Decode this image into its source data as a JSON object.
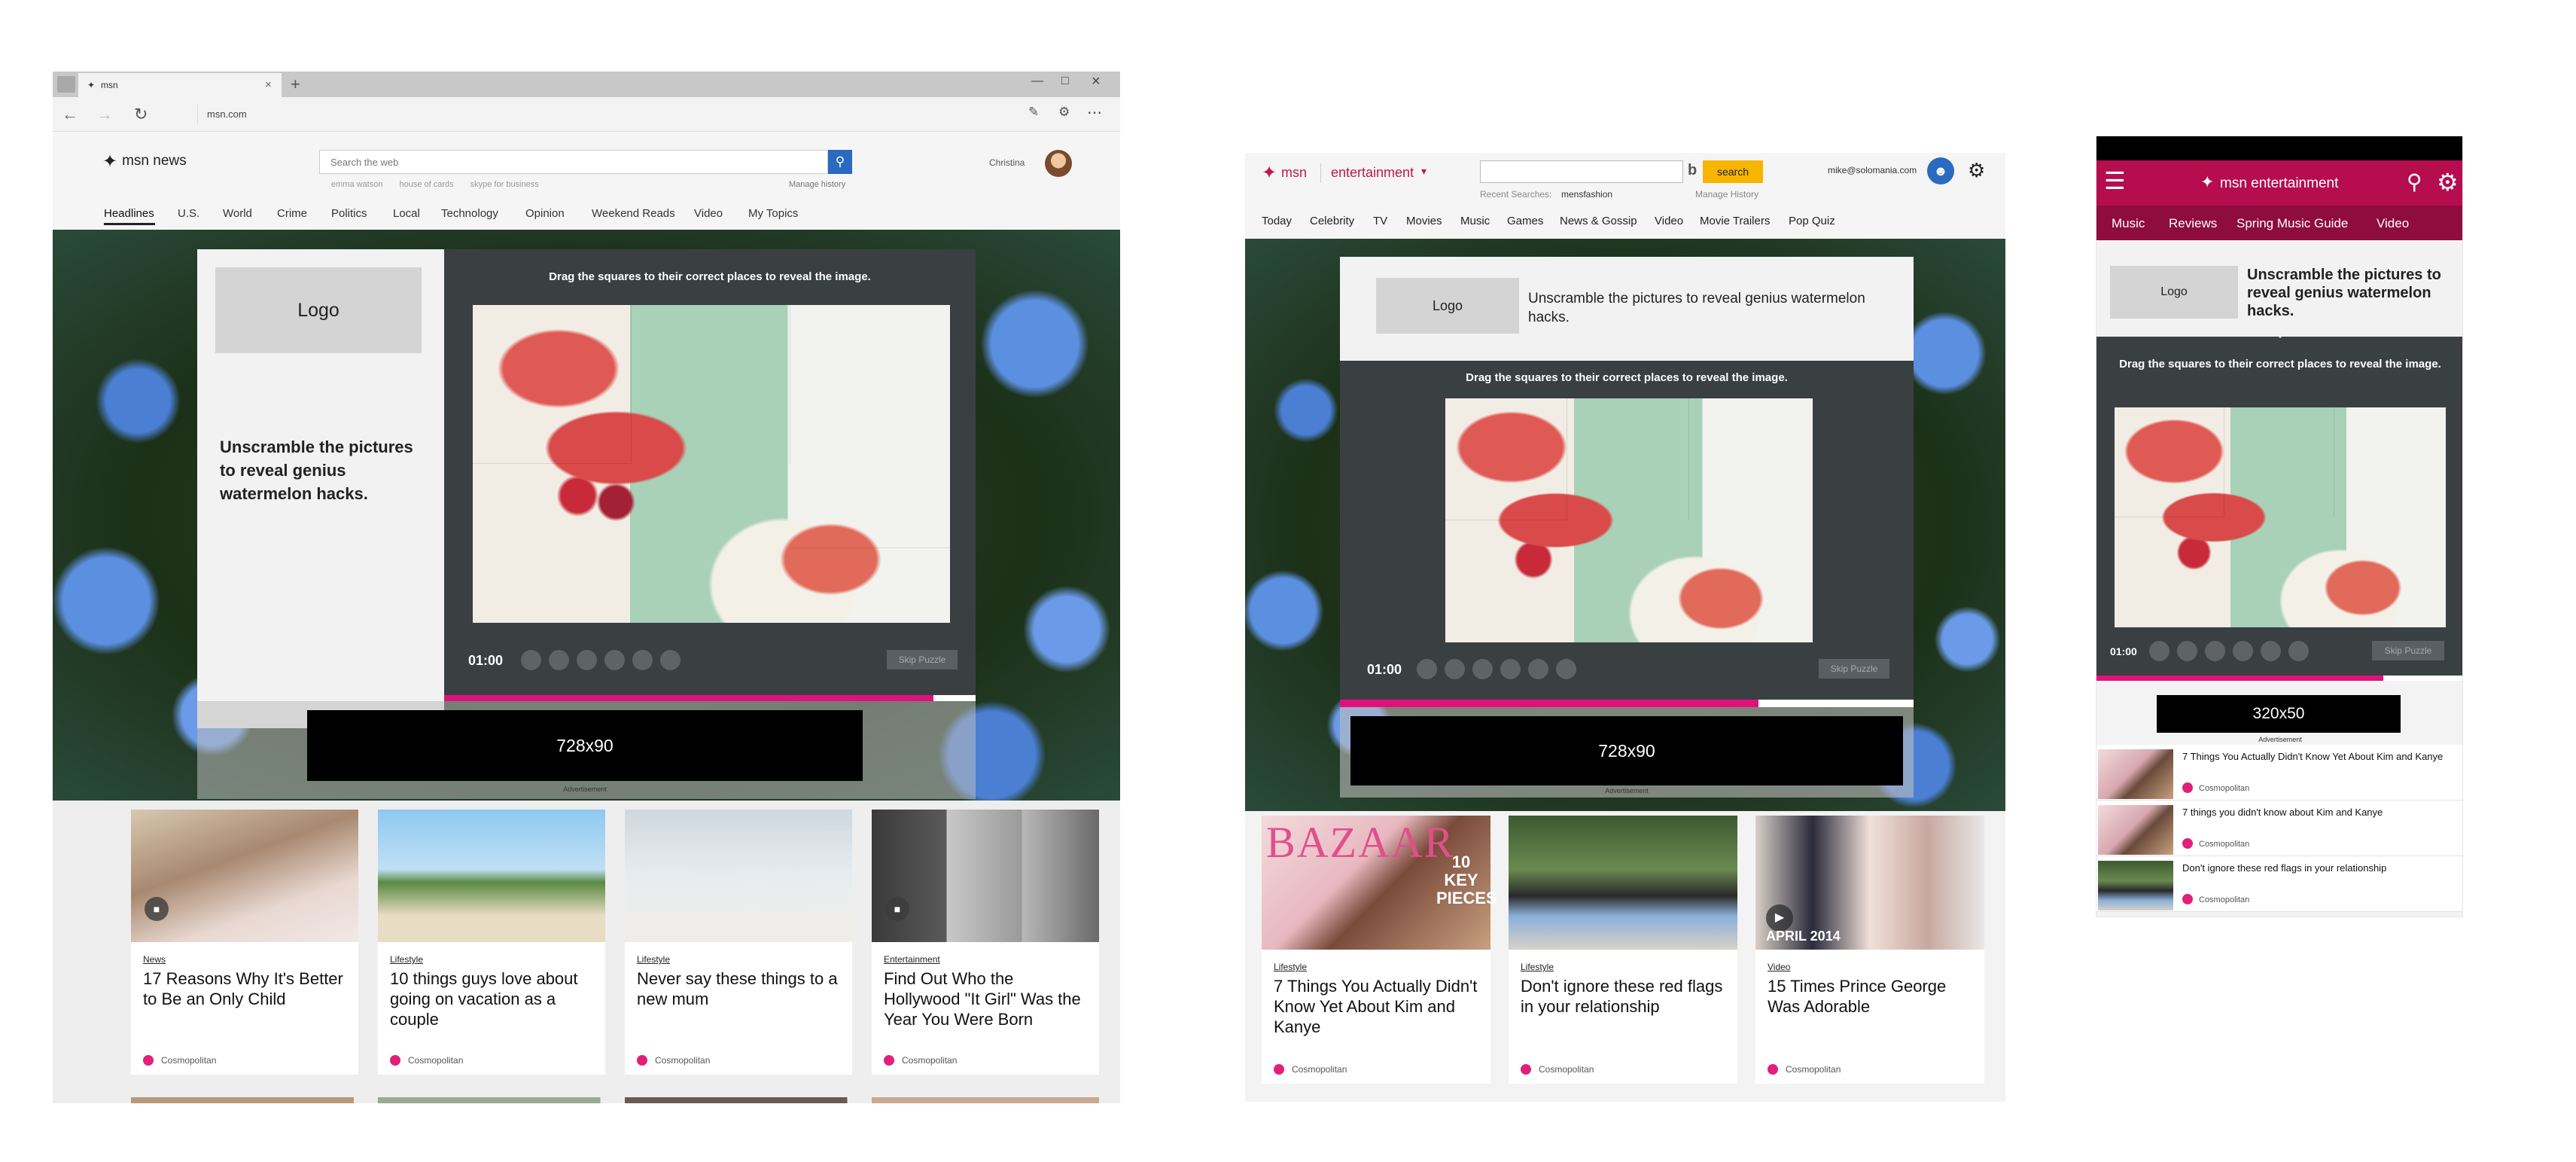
{
  "desktop": {
    "browser": {
      "tab_label": "msn",
      "address": "msn.com"
    },
    "header": {
      "logo": "msn news",
      "search_placeholder": "Search the web",
      "recent_searches": [
        "emma watson",
        "house of cards",
        "skype for business"
      ],
      "manage_history": "Manage history",
      "username": "Christina"
    },
    "nav": [
      "Headlines",
      "U.S.",
      "World",
      "Crime",
      "Politics",
      "Local",
      "Technology",
      "Opinion",
      "Weekend Reads",
      "Video",
      "My Topics"
    ],
    "promo": {
      "logo": "Logo",
      "headline": "Unscramble the pictures to reveal genius watermelon hacks.",
      "instruction": "Drag the squares to their correct places to reveal the image.",
      "timer": "01:00",
      "skip": "Skip Puzzle",
      "progress": 0.92
    },
    "ad": {
      "size": "728x90",
      "label": "Advertisement"
    },
    "cards": [
      {
        "category": "News",
        "title": "17 Reasons Why It's Better to Be an Only Child",
        "source": "Cosmopolitan"
      },
      {
        "category": "Lifestyle",
        "title": "10 things guys love about going on vacation as a couple",
        "source": "Cosmopolitan"
      },
      {
        "category": "Lifestyle",
        "title": "Never say these things to a new mum",
        "source": "Cosmopolitan"
      },
      {
        "category": "Entertainment",
        "title": "Find Out Who the Hollywood \"It Girl\" Was the Year You Were Born",
        "source": "Cosmopolitan"
      }
    ]
  },
  "tablet": {
    "header": {
      "logo": "msn",
      "section": "entertainment",
      "search_button": "search",
      "recent_label": "Recent Searches:",
      "recent_value": "mensfashion",
      "manage_history": "Manage History",
      "email": "mike@solomania.com"
    },
    "nav": [
      "Today",
      "Celebrity",
      "TV",
      "Movies",
      "Music",
      "Games",
      "News & Gossip",
      "Video",
      "Movie Trailers",
      "Pop Quiz"
    ],
    "promo": {
      "logo": "Logo",
      "headline": "Unscramble the pictures to reveal genius watermelon hacks.",
      "instruction": "Drag the squares to their correct places to reveal the image.",
      "timer": "01:00",
      "skip": "Skip Puzzle",
      "progress": 0.73
    },
    "ad": {
      "size": "728x90",
      "label": "Advertisement"
    },
    "cards": [
      {
        "category": "Lifestyle",
        "title": "7 Things You Actually Didn't Know Yet About Kim and Kanye",
        "source": "Cosmopolitan",
        "overlay": "BAZAAR",
        "badge": "10 KEY PIECES"
      },
      {
        "category": "Lifestyle",
        "title": "Don't ignore these red flags in your relationship",
        "source": "Cosmopolitan"
      },
      {
        "category": "Video",
        "title": "15 Times Prince George Was Adorable",
        "source": "Cosmopolitan",
        "overlay": "APRIL 2014"
      }
    ]
  },
  "mobile": {
    "header": {
      "logo": "msn entertainment"
    },
    "nav": [
      "Music",
      "Reviews",
      "Spring Music Guide",
      "Video"
    ],
    "promo": {
      "logo": "Logo",
      "headline": "Unscramble the pictures to reveal genius watermelon hacks.",
      "instruction": "Drag the squares to their correct places to reveal the image.",
      "timer": "01:00",
      "skip": "Skip Puzzle",
      "progress": 0.78
    },
    "ad": {
      "size": "320x50",
      "label": "Advertisement"
    },
    "list": [
      {
        "title": "7 Things You Actually Didn't Know Yet About Kim and Kanye",
        "source": "Cosmopolitan"
      },
      {
        "title": "7 things you didn't know about Kim and Kanye",
        "source": "Cosmopolitan"
      },
      {
        "title": "Don't ignore these red flags in your relationship",
        "source": "Cosmopolitan"
      }
    ]
  },
  "colors": {
    "accent_pink": "#e0127a",
    "msn_blue": "#2a6ac0",
    "mobile_header": "#b50d4f",
    "search_yellow": "#f7b500"
  }
}
